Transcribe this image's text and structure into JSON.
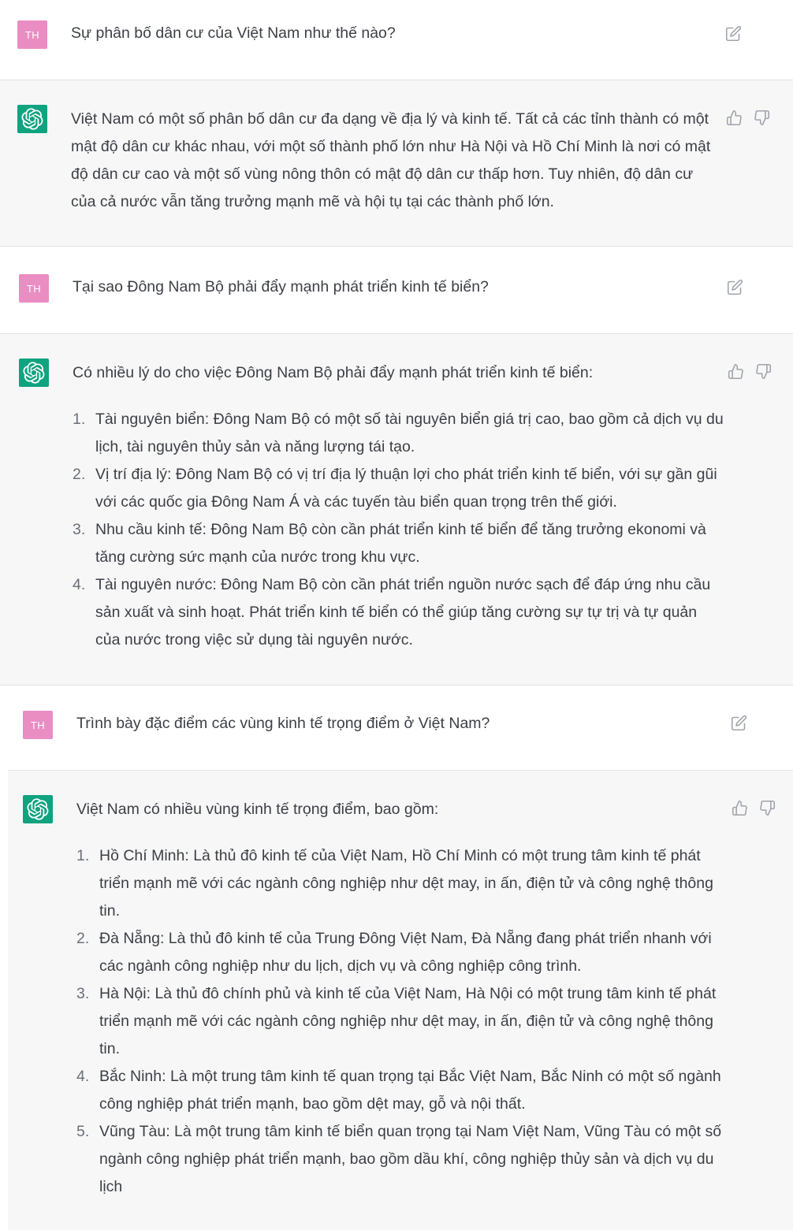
{
  "conversation": [
    {
      "role": "user",
      "avatar": "TH",
      "text": "Sự phân bố dân cư của Việt Nam như thế nào?"
    },
    {
      "role": "assistant",
      "intro": "Việt Nam có một số phân bố dân cư đa dạng về địa lý và kinh tế. Tất cả các tỉnh thành có một mật độ dân cư khác nhau, với một số thành phố lớn như Hà Nội và Hồ Chí Minh là nơi có mật độ dân cư cao và một số vùng nông thôn có mật độ dân cư thấp hơn. Tuy nhiên, độ dân cư của cả nước vẫn tăng trưởng mạnh mẽ và hội tụ tại các thành phố lớn."
    },
    {
      "role": "user",
      "avatar": "TH",
      "text": "Tại sao Đông Nam Bộ phải đẩy mạnh phát triển kinh tế biển?"
    },
    {
      "role": "assistant",
      "intro": "Có nhiều lý do cho việc Đông Nam Bộ phải đẩy mạnh phát triển kinh tế biển:",
      "items": [
        {
          "num": "1.",
          "text": "Tài nguyên biển: Đông Nam Bộ có một số tài nguyên biển giá trị cao, bao gồm cả dịch vụ du lịch, tài nguyên thủy sản và năng lượng tái tạo."
        },
        {
          "num": "2.",
          "text": "Vị trí địa lý: Đông Nam Bộ có vị trí địa lý thuận lợi cho phát triển kinh tế biển, với sự gần gũi với các quốc gia Đông Nam Á và các tuyến tàu biển quan trọng trên thế giới."
        },
        {
          "num": "3.",
          "text": "Nhu cầu kinh tế: Đông Nam Bộ còn cần phát triển kinh tế biển để tăng trưởng ekonomi và tăng cường sức mạnh của nước trong khu vực."
        },
        {
          "num": "4.",
          "text": "Tài nguyên nước: Đông Nam Bộ còn cần phát triển nguồn nước sạch để đáp ứng nhu cầu sản xuất và sinh hoạt. Phát triển kinh tế biển có thể giúp tăng cường sự tự trị và tự quản của nước trong việc sử dụng tài nguyên nước."
        }
      ]
    },
    {
      "role": "user",
      "avatar": "TH",
      "text": "Trình bày đặc điểm các vùng kinh tế trọng điểm ở Việt Nam?"
    },
    {
      "role": "assistant",
      "intro": "Việt Nam có nhiều vùng kinh tế trọng điểm, bao gồm:",
      "items": [
        {
          "num": "1.",
          "text": "Hồ Chí Minh: Là thủ đô kinh tế của Việt Nam, Hồ Chí Minh có một trung tâm kinh tế phát triển mạnh mẽ với các ngành công nghiệp như dệt may, in ấn, điện tử và công nghệ thông tin."
        },
        {
          "num": "2.",
          "text": "Đà Nẵng: Là thủ đô kinh tế của Trung Đông Việt Nam, Đà Nẵng đang phát triển nhanh với các ngành công nghiệp như du lịch, dịch vụ và công nghiệp công trình."
        },
        {
          "num": "3.",
          "text": "Hà Nội: Là thủ đô chính phủ và kinh tế của Việt Nam, Hà Nội có một trung tâm kinh tế phát triển mạnh mẽ với các ngành công nghiệp như dệt may, in ấn, điện tử và công nghệ thông tin."
        },
        {
          "num": "4.",
          "text": "Bắc Ninh: Là một trung tâm kinh tế quan trọng tại Bắc Việt Nam, Bắc Ninh có một số ngành công nghiệp phát triển mạnh, bao gồm dệt may, gỗ và nội thất."
        },
        {
          "num": "5.",
          "text": "Vũng Tàu: Là một trung tâm kinh tế biển quan trọng tại Nam Việt Nam, Vũng Tàu có một số ngành công nghiệp phát triển mạnh, bao gồm dầu khí, công nghiệp thủy sản và dịch vụ du lịch"
        }
      ]
    }
  ],
  "icons": {
    "user_action": "edit-icon",
    "assistant_actions": [
      "thumbs-up-icon",
      "thumbs-down-icon"
    ]
  },
  "colors": {
    "user_avatar": "#e98dc3",
    "assistant_avatar": "#10a37f",
    "assistant_bg": "#f7f7f8"
  }
}
